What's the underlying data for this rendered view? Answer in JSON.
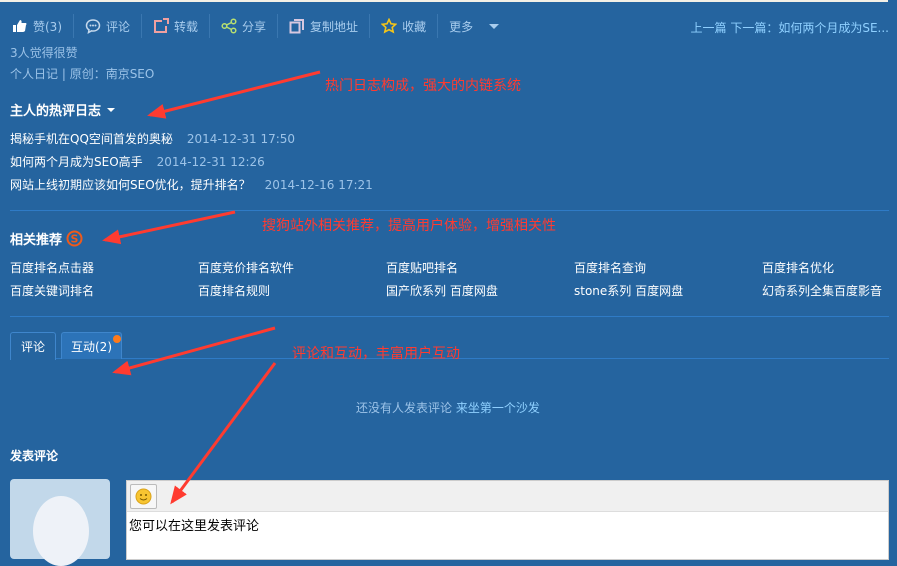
{
  "toolbar": {
    "items": [
      {
        "icon": "thumbs-up-icon",
        "label": "赞(3)"
      },
      {
        "icon": "comment-icon",
        "label": "评论"
      },
      {
        "icon": "repost-icon",
        "label": "转载"
      },
      {
        "icon": "share-icon",
        "label": "分享"
      },
      {
        "icon": "copy-icon",
        "label": "复制地址"
      },
      {
        "icon": "star-icon",
        "label": "收藏"
      },
      {
        "icon": "chevron-down-icon",
        "label": "更多"
      }
    ]
  },
  "nav": {
    "text": "上一篇 下一篇：如何两个月成为SE..."
  },
  "likes": "3人觉得很赞",
  "meta": {
    "category": "个人日记",
    "separator": " | ",
    "source": "原创：南京SEO"
  },
  "hot": {
    "title": "主人的热评日志",
    "posts": [
      {
        "title": "揭秘手机在QQ空间首发的奥秘",
        "time": "2014-12-31 17:50"
      },
      {
        "title": "如何两个月成为SEO高手",
        "time": "2014-12-31 12:26"
      },
      {
        "title": "网站上线初期应该如何SEO优化，提升排名？",
        "time": "2014-12-16 17:21"
      }
    ]
  },
  "related": {
    "title": "相关推荐",
    "items": [
      "百度排名点击器",
      "百度竞价排名软件",
      "百度贴吧排名",
      "百度排名查询",
      "百度排名优化",
      "百度关键词排名",
      "百度排名规则",
      "国产欣系列 百度网盘",
      "stone系列 百度网盘",
      "幻奇系列全集百度影音"
    ]
  },
  "tabs": [
    {
      "label": "评论"
    },
    {
      "label": "互动(2)"
    }
  ],
  "empty": {
    "text": "还没有人发表评论",
    "link": "来坐第一个沙发"
  },
  "compose": {
    "title": "发表评论",
    "placeholder": "您可以在这里发表评论"
  },
  "annotations": [
    "热门日志构成，强大的内链系统",
    "搜狗站外相关推荐，提高用户体验，增强相关性",
    "评论和互动，丰富用户互动"
  ],
  "colors": {
    "background": "#25649f",
    "annotation": "#ff3b30",
    "link": "#8fd0ff"
  }
}
